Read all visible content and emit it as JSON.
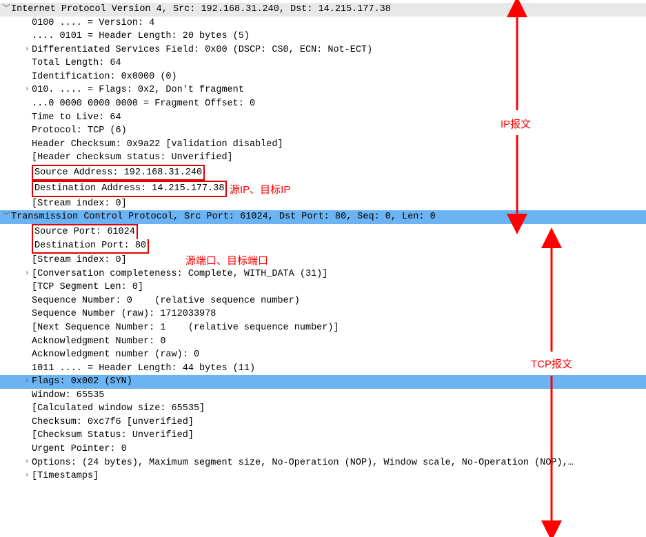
{
  "ip_section": {
    "header": "Internet Protocol Version 4, Src: 192.168.31.240, Dst: 14.215.177.38",
    "lines": {
      "version": "0100 .... = Version: 4",
      "hlen": ".... 0101 = Header Length: 20 bytes (5)",
      "dsf": "Differentiated Services Field: 0x00 (DSCP: CS0, ECN: Not-ECT)",
      "total_len": "Total Length: 64",
      "ident": "Identification: 0x0000 (0)",
      "flags": "010. .... = Flags: 0x2, Don't fragment",
      "fragoff": "...0 0000 0000 0000 = Fragment Offset: 0",
      "ttl": "Time to Live: 64",
      "proto": "Protocol: TCP (6)",
      "hchk": "Header Checksum: 0x9a22 [validation disabled]",
      "hchk_stat": "[Header checksum status: Unverified]",
      "src_addr": "Source Address: 192.168.31.240",
      "dst_addr": "Destination Address: 14.215.177.38",
      "stream": "[Stream index: 0]"
    }
  },
  "tcp_section": {
    "header": "Transmission Control Protocol, Src Port: 61024, Dst Port: 80, Seq: 0, Len: 0",
    "lines": {
      "src_port": "Source Port: 61024",
      "dst_port": "Destination Port: 80",
      "stream": "[Stream index: 0]",
      "conv": "[Conversation completeness: Complete, WITH_DATA (31)]",
      "seglen": "[TCP Segment Len: 0]",
      "seqnum": "Sequence Number: 0    (relative sequence number)",
      "seqraw": "Sequence Number (raw): 1712033978",
      "nextseq": "[Next Sequence Number: 1    (relative sequence number)]",
      "acknum": "Acknowledgment Number: 0",
      "ackraw": "Acknowledgment number (raw): 0",
      "hlen": "1011 .... = Header Length: 44 bytes (11)",
      "flags": "Flags: 0x002 (SYN)",
      "window": "Window: 65535",
      "calcwin": "[Calculated window size: 65535]",
      "checksum": "Checksum: 0xc7f6 [unverified]",
      "chkstat": "[Checksum Status: Unverified]",
      "urgptr": "Urgent Pointer: 0",
      "options": "Options: (24 bytes), Maximum segment size, No-Operation (NOP), Window scale, No-Operation (NOP),…",
      "timestamps": "[Timestamps]"
    }
  },
  "annotations": {
    "ip_label": "IP报文",
    "tcp_label": "TCP报文",
    "src_dst_ip": "源IP、目标IP",
    "src_dst_port": "源端口、目标端口"
  }
}
